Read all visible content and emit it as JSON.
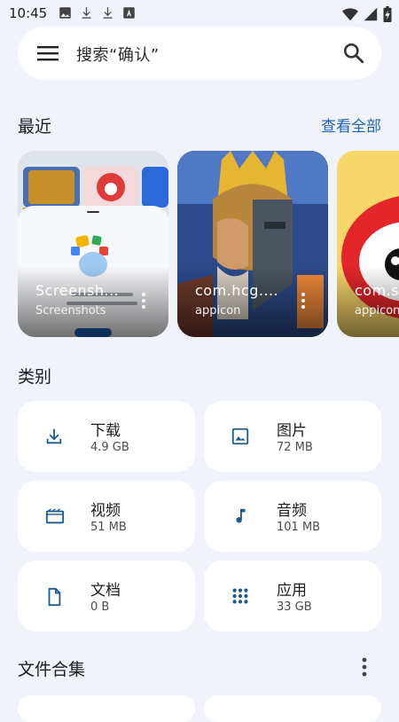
{
  "status_bar": {
    "time": "10:45",
    "left_icons": [
      "image-icon",
      "download-icon",
      "download-icon",
      "font-icon"
    ],
    "right_icons": [
      "wifi-icon",
      "signal-icon",
      "battery-charging-icon"
    ]
  },
  "search": {
    "placeholder": "搜索“确认”"
  },
  "recent": {
    "title": "最近",
    "view_all": "查看全部",
    "items": [
      {
        "title": "Screensh...",
        "subtitle": "Screenshots"
      },
      {
        "title": "com.hcg....",
        "subtitle": "appicon"
      },
      {
        "title": "com.s",
        "subtitle": "appicon"
      }
    ]
  },
  "categories": {
    "title": "类别",
    "items": [
      {
        "name": "下载",
        "size": "4.9 GB",
        "icon": "download-icon"
      },
      {
        "name": "图片",
        "size": "72 MB",
        "icon": "image-icon"
      },
      {
        "name": "视频",
        "size": "51 MB",
        "icon": "video-icon"
      },
      {
        "name": "音频",
        "size": "101 MB",
        "icon": "audio-icon"
      },
      {
        "name": "文档",
        "size": "0 B",
        "icon": "document-icon"
      },
      {
        "name": "应用",
        "size": "33 GB",
        "icon": "apps-grid-icon"
      }
    ]
  },
  "collections": {
    "title": "文件合集"
  },
  "colors": {
    "background": "#f0f3fa",
    "card": "#ffffff",
    "accent": "#1f63b8",
    "icon": "#1a5a8e"
  }
}
